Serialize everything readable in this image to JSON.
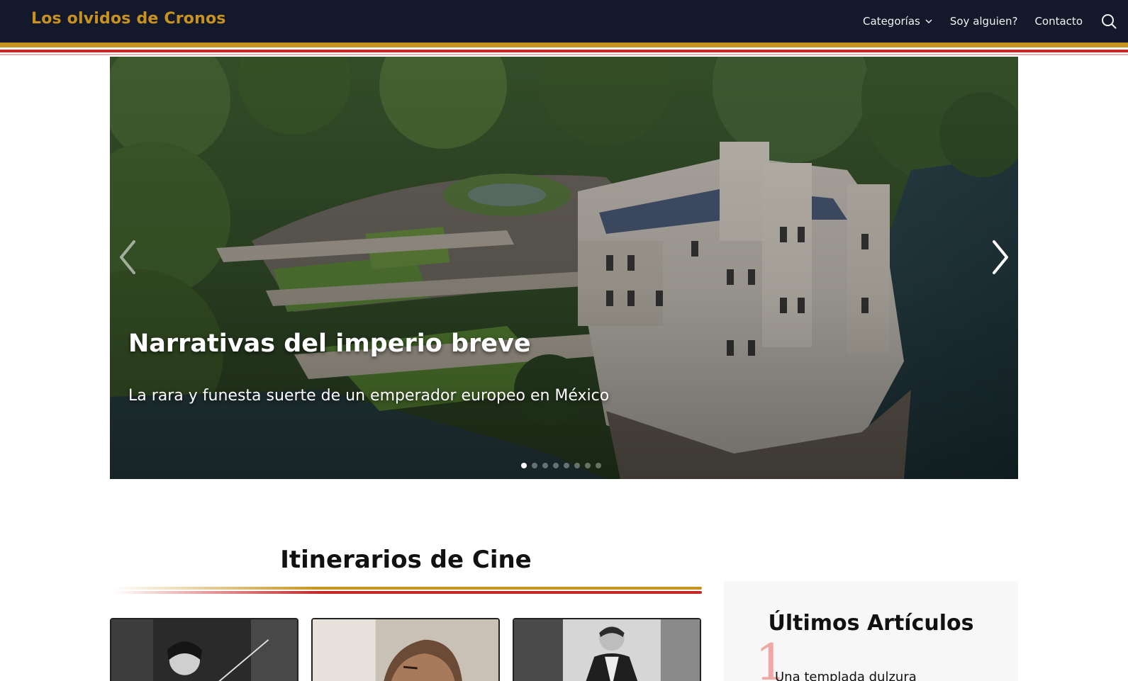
{
  "header": {
    "brand": "Los olvidos de Cronos",
    "nav": [
      {
        "label": "Categorías",
        "has_dropdown": true
      },
      {
        "label": "Soy alguien?"
      },
      {
        "label": "Contacto"
      }
    ],
    "search_icon": "search-icon"
  },
  "colors": {
    "header_bg": "#13182b",
    "brand": "#c8921f",
    "accent_red": "#c62828"
  },
  "hero": {
    "title": "Narrativas del imperio breve",
    "subtitle": "La rara y funesta suerte de un emperador europeo en México",
    "slide_count": 8,
    "active_slide": 1
  },
  "section": {
    "title": "Itinerarios de Cine"
  },
  "sidebar": {
    "title": "Últimos Artículos",
    "items": [
      {
        "rank": "1",
        "title": "Una templada dulzura"
      }
    ]
  }
}
